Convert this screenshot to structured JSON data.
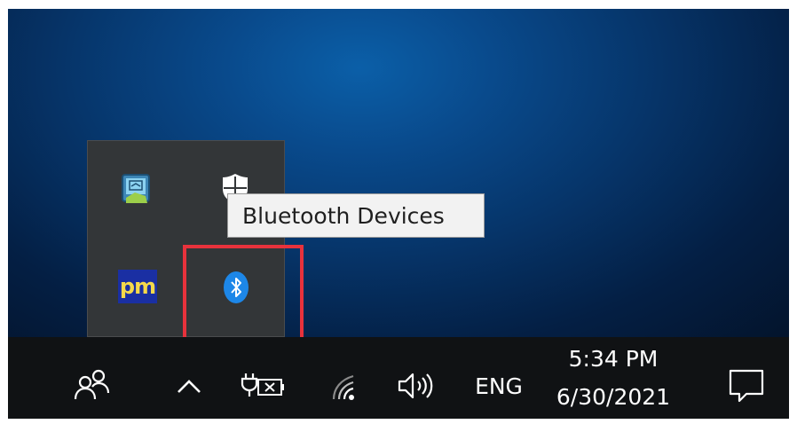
{
  "tooltip": {
    "text": "Bluetooth Devices"
  },
  "flyout": {
    "items": [
      {
        "name": "network-monitor-icon",
        "kind": "app"
      },
      {
        "name": "windows-security-icon",
        "kind": "security"
      },
      {
        "name": "pm-app-icon",
        "label": "pm"
      },
      {
        "name": "bluetooth-icon",
        "kind": "bluetooth"
      }
    ]
  },
  "taskbar": {
    "people_icon": "people-icon",
    "overflow_icon": "chevron-up-icon",
    "power_icon": "power-plug-icon",
    "wifi_icon": "wifi-icon",
    "volume_icon": "volume-icon",
    "language": "ENG",
    "time": "5:34 PM",
    "date": "6/30/2021",
    "notifications_icon": "action-center-icon"
  },
  "colors": {
    "highlight": "#e8323c",
    "bluetooth": "#1d87e8",
    "taskbar": "#101214"
  }
}
